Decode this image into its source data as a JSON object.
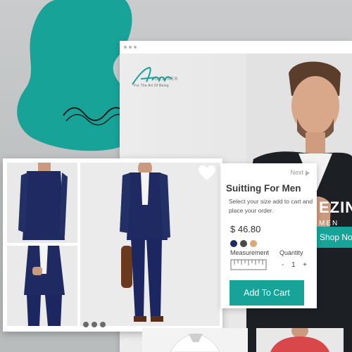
{
  "colors": {
    "teal": "#17a398",
    "navy": "#1f2a63",
    "charcoal": "#4a4a4a",
    "tan": "#d6ab73"
  },
  "logo": {
    "name": "DEZINER",
    "tagline": "For The Art Of Being"
  },
  "hero": {
    "headline": "EZINE",
    "subline": "MEN CO",
    "shop_label": "Shop No"
  },
  "product": {
    "next_label": "Next",
    "title": "Suitting For Men",
    "description": "Select your size add to cart and place your order.",
    "price": "$ 46.80",
    "swatches": [
      "navy",
      "charcoal",
      "tan"
    ],
    "measurement_label": "Measurement",
    "quantity_label": "Quantity",
    "quantity": "1",
    "decrement": "-",
    "increment": "+",
    "add_to_cart_label": "Add To Cart",
    "icons": [
      "heart-icon",
      "ruler-icon",
      "next-arrow-icon"
    ]
  }
}
